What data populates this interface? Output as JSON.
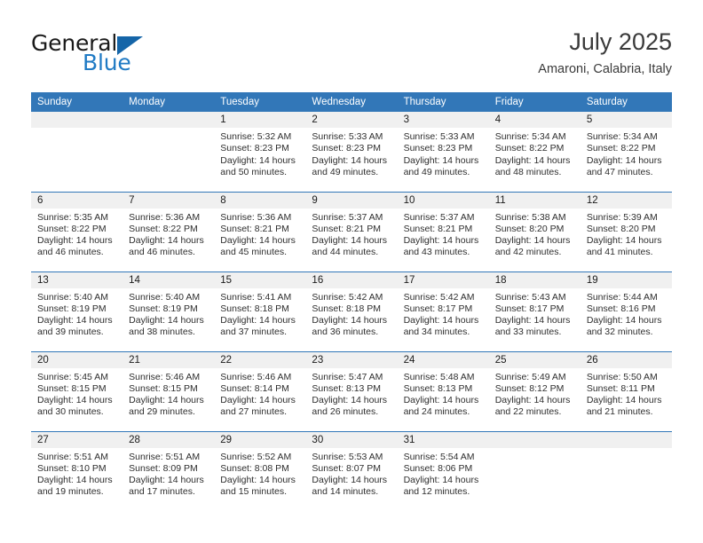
{
  "brand": {
    "name_part1": "General",
    "name_part2": "Blue",
    "logo_icon": "triangle-logo-icon"
  },
  "header": {
    "month_title": "July 2025",
    "location": "Amaroni, Calabria, Italy"
  },
  "calendar": {
    "weekday_headers": [
      "Sunday",
      "Monday",
      "Tuesday",
      "Wednesday",
      "Thursday",
      "Friday",
      "Saturday"
    ],
    "colors": {
      "header_bar": "#3277b8",
      "daynum_bg": "#f0f0f0",
      "row_divider": "#3277b8",
      "brand_blue": "#1f7ac4",
      "text": "#2e2e2e"
    },
    "labels": {
      "sunrise": "Sunrise:",
      "sunset": "Sunset:",
      "daylight": "Daylight:"
    },
    "weeks": [
      [
        {
          "day": ""
        },
        {
          "day": ""
        },
        {
          "day": "1",
          "sunrise": "Sunrise: 5:32 AM",
          "sunset": "Sunset: 8:23 PM",
          "daylight": "Daylight: 14 hours and 50 minutes."
        },
        {
          "day": "2",
          "sunrise": "Sunrise: 5:33 AM",
          "sunset": "Sunset: 8:23 PM",
          "daylight": "Daylight: 14 hours and 49 minutes."
        },
        {
          "day": "3",
          "sunrise": "Sunrise: 5:33 AM",
          "sunset": "Sunset: 8:23 PM",
          "daylight": "Daylight: 14 hours and 49 minutes."
        },
        {
          "day": "4",
          "sunrise": "Sunrise: 5:34 AM",
          "sunset": "Sunset: 8:22 PM",
          "daylight": "Daylight: 14 hours and 48 minutes."
        },
        {
          "day": "5",
          "sunrise": "Sunrise: 5:34 AM",
          "sunset": "Sunset: 8:22 PM",
          "daylight": "Daylight: 14 hours and 47 minutes."
        }
      ],
      [
        {
          "day": "6",
          "sunrise": "Sunrise: 5:35 AM",
          "sunset": "Sunset: 8:22 PM",
          "daylight": "Daylight: 14 hours and 46 minutes."
        },
        {
          "day": "7",
          "sunrise": "Sunrise: 5:36 AM",
          "sunset": "Sunset: 8:22 PM",
          "daylight": "Daylight: 14 hours and 46 minutes."
        },
        {
          "day": "8",
          "sunrise": "Sunrise: 5:36 AM",
          "sunset": "Sunset: 8:21 PM",
          "daylight": "Daylight: 14 hours and 45 minutes."
        },
        {
          "day": "9",
          "sunrise": "Sunrise: 5:37 AM",
          "sunset": "Sunset: 8:21 PM",
          "daylight": "Daylight: 14 hours and 44 minutes."
        },
        {
          "day": "10",
          "sunrise": "Sunrise: 5:37 AM",
          "sunset": "Sunset: 8:21 PM",
          "daylight": "Daylight: 14 hours and 43 minutes."
        },
        {
          "day": "11",
          "sunrise": "Sunrise: 5:38 AM",
          "sunset": "Sunset: 8:20 PM",
          "daylight": "Daylight: 14 hours and 42 minutes."
        },
        {
          "day": "12",
          "sunrise": "Sunrise: 5:39 AM",
          "sunset": "Sunset: 8:20 PM",
          "daylight": "Daylight: 14 hours and 41 minutes."
        }
      ],
      [
        {
          "day": "13",
          "sunrise": "Sunrise: 5:40 AM",
          "sunset": "Sunset: 8:19 PM",
          "daylight": "Daylight: 14 hours and 39 minutes."
        },
        {
          "day": "14",
          "sunrise": "Sunrise: 5:40 AM",
          "sunset": "Sunset: 8:19 PM",
          "daylight": "Daylight: 14 hours and 38 minutes."
        },
        {
          "day": "15",
          "sunrise": "Sunrise: 5:41 AM",
          "sunset": "Sunset: 8:18 PM",
          "daylight": "Daylight: 14 hours and 37 minutes."
        },
        {
          "day": "16",
          "sunrise": "Sunrise: 5:42 AM",
          "sunset": "Sunset: 8:18 PM",
          "daylight": "Daylight: 14 hours and 36 minutes."
        },
        {
          "day": "17",
          "sunrise": "Sunrise: 5:42 AM",
          "sunset": "Sunset: 8:17 PM",
          "daylight": "Daylight: 14 hours and 34 minutes."
        },
        {
          "day": "18",
          "sunrise": "Sunrise: 5:43 AM",
          "sunset": "Sunset: 8:17 PM",
          "daylight": "Daylight: 14 hours and 33 minutes."
        },
        {
          "day": "19",
          "sunrise": "Sunrise: 5:44 AM",
          "sunset": "Sunset: 8:16 PM",
          "daylight": "Daylight: 14 hours and 32 minutes."
        }
      ],
      [
        {
          "day": "20",
          "sunrise": "Sunrise: 5:45 AM",
          "sunset": "Sunset: 8:15 PM",
          "daylight": "Daylight: 14 hours and 30 minutes."
        },
        {
          "day": "21",
          "sunrise": "Sunrise: 5:46 AM",
          "sunset": "Sunset: 8:15 PM",
          "daylight": "Daylight: 14 hours and 29 minutes."
        },
        {
          "day": "22",
          "sunrise": "Sunrise: 5:46 AM",
          "sunset": "Sunset: 8:14 PM",
          "daylight": "Daylight: 14 hours and 27 minutes."
        },
        {
          "day": "23",
          "sunrise": "Sunrise: 5:47 AM",
          "sunset": "Sunset: 8:13 PM",
          "daylight": "Daylight: 14 hours and 26 minutes."
        },
        {
          "day": "24",
          "sunrise": "Sunrise: 5:48 AM",
          "sunset": "Sunset: 8:13 PM",
          "daylight": "Daylight: 14 hours and 24 minutes."
        },
        {
          "day": "25",
          "sunrise": "Sunrise: 5:49 AM",
          "sunset": "Sunset: 8:12 PM",
          "daylight": "Daylight: 14 hours and 22 minutes."
        },
        {
          "day": "26",
          "sunrise": "Sunrise: 5:50 AM",
          "sunset": "Sunset: 8:11 PM",
          "daylight": "Daylight: 14 hours and 21 minutes."
        }
      ],
      [
        {
          "day": "27",
          "sunrise": "Sunrise: 5:51 AM",
          "sunset": "Sunset: 8:10 PM",
          "daylight": "Daylight: 14 hours and 19 minutes."
        },
        {
          "day": "28",
          "sunrise": "Sunrise: 5:51 AM",
          "sunset": "Sunset: 8:09 PM",
          "daylight": "Daylight: 14 hours and 17 minutes."
        },
        {
          "day": "29",
          "sunrise": "Sunrise: 5:52 AM",
          "sunset": "Sunset: 8:08 PM",
          "daylight": "Daylight: 14 hours and 15 minutes."
        },
        {
          "day": "30",
          "sunrise": "Sunrise: 5:53 AM",
          "sunset": "Sunset: 8:07 PM",
          "daylight": "Daylight: 14 hours and 14 minutes."
        },
        {
          "day": "31",
          "sunrise": "Sunrise: 5:54 AM",
          "sunset": "Sunset: 8:06 PM",
          "daylight": "Daylight: 14 hours and 12 minutes."
        },
        {
          "day": ""
        },
        {
          "day": ""
        }
      ]
    ]
  }
}
